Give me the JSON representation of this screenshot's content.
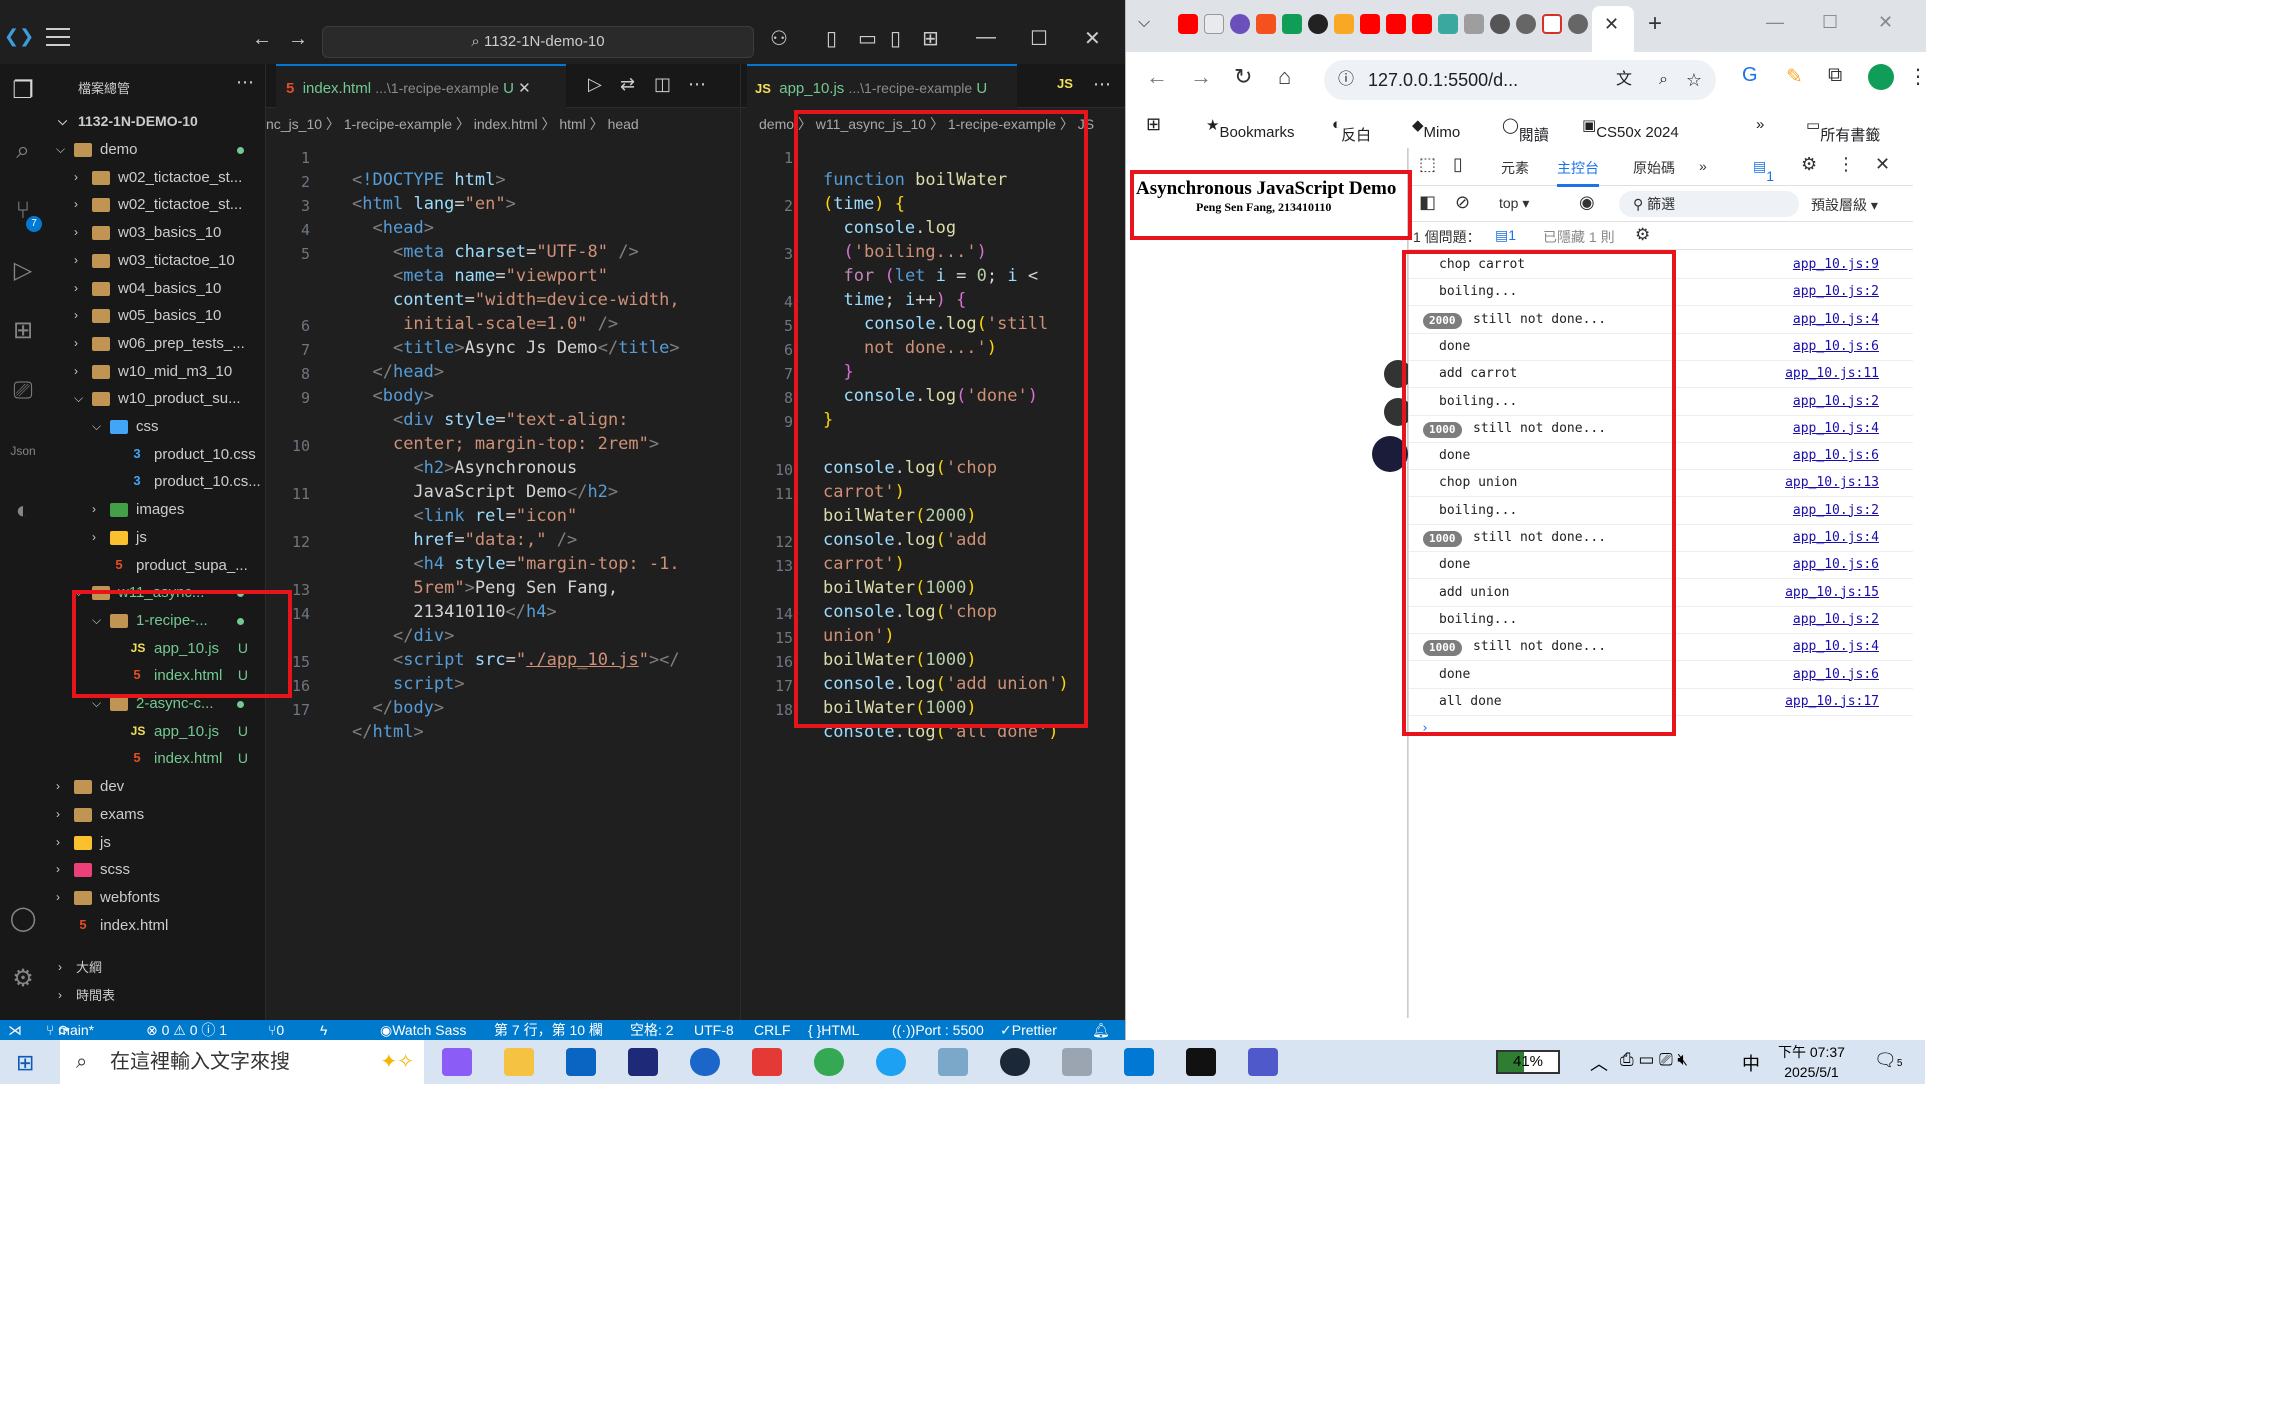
{
  "vscode": {
    "search_text": "1132-1N-demo-10",
    "explorer_title": "檔案總管",
    "workspace": "1132-1N-DEMO-10",
    "tree": [
      {
        "label": "demo",
        "indent": 0,
        "type": "folder",
        "open": true,
        "dot": true
      },
      {
        "label": "w02_tictactoe_st...",
        "indent": 1,
        "type": "folder"
      },
      {
        "label": "w02_tictactoe_st...",
        "indent": 1,
        "type": "folder"
      },
      {
        "label": "w03_basics_10",
        "indent": 1,
        "type": "folder"
      },
      {
        "label": "w03_tictactoe_10",
        "indent": 1,
        "type": "folder"
      },
      {
        "label": "w04_basics_10",
        "indent": 1,
        "type": "folder"
      },
      {
        "label": "w05_basics_10",
        "indent": 1,
        "type": "folder"
      },
      {
        "label": "w06_prep_tests_...",
        "indent": 1,
        "type": "folder"
      },
      {
        "label": "w10_mid_m3_10",
        "indent": 1,
        "type": "folder"
      },
      {
        "label": "w10_product_su...",
        "indent": 1,
        "type": "folder",
        "open": true
      },
      {
        "label": "css",
        "indent": 2,
        "type": "folder-css",
        "open": true
      },
      {
        "label": "product_10.css",
        "indent": 3,
        "type": "file-css"
      },
      {
        "label": "product_10.cs...",
        "indent": 3,
        "type": "file-css"
      },
      {
        "label": "images",
        "indent": 2,
        "type": "folder-img"
      },
      {
        "label": "js",
        "indent": 2,
        "type": "folder-js"
      },
      {
        "label": "product_supa_...",
        "indent": 2,
        "type": "file-html"
      },
      {
        "label": "w11_async...",
        "indent": 1,
        "type": "folder",
        "open": true,
        "dot": true,
        "green": true
      },
      {
        "label": "1-recipe-...",
        "indent": 2,
        "type": "folder",
        "open": true,
        "dot": true,
        "green": true
      },
      {
        "label": "app_10.js",
        "indent": 3,
        "type": "file-js",
        "status": "U",
        "green": true
      },
      {
        "label": "index.html",
        "indent": 3,
        "type": "file-html",
        "status": "U",
        "green": true
      },
      {
        "label": "2-async-c...",
        "indent": 2,
        "type": "folder",
        "open": true,
        "dot": true,
        "green": true
      },
      {
        "label": "app_10.js",
        "indent": 3,
        "type": "file-js",
        "status": "U",
        "green": true
      },
      {
        "label": "index.html",
        "indent": 3,
        "type": "file-html",
        "status": "U",
        "green": true
      },
      {
        "label": "dev",
        "indent": 0,
        "type": "folder"
      },
      {
        "label": "exams",
        "indent": 0,
        "type": "folder"
      },
      {
        "label": "js",
        "indent": 0,
        "type": "folder-js"
      },
      {
        "label": "scss",
        "indent": 0,
        "type": "folder-scss"
      },
      {
        "label": "webfonts",
        "indent": 0,
        "type": "folder"
      },
      {
        "label": "index.html",
        "indent": 0,
        "type": "file-html",
        "nochev": true
      }
    ],
    "outline_label": "大綱",
    "timeline_label": "時間表",
    "left_tab": {
      "name": "index.html",
      "path": "...\\1-recipe-example",
      "status": "U"
    },
    "left_crumb": "nc_js_10 〉 1-recipe-example 〉 index.html 〉 html 〉 head",
    "right_tab": {
      "name": "app_10.js",
      "path": "...\\1-recipe-example",
      "status": "U"
    },
    "right_crumb": "demo 〉 w11_async_js_10 〉 1-recipe-example 〉 JS",
    "html_line_numbers": [
      "1",
      "2",
      "3",
      "4",
      "5",
      "",
      "",
      "6",
      "7",
      "8",
      "9",
      "",
      "10",
      "",
      "11",
      "",
      "12",
      "",
      "13",
      "14",
      "",
      "15",
      "16",
      "17"
    ],
    "js_line_numbers": [
      "1",
      "",
      "2",
      "",
      "3",
      "",
      "4",
      "5",
      "6",
      "7",
      "8",
      "9",
      "",
      "10",
      "11",
      "",
      "12",
      "13",
      "",
      "14",
      "15",
      "16",
      "17",
      "18"
    ],
    "statusbar": {
      "branch": "main*",
      "problems": "⊗ 0 ⚠ 0 ⓘ 1",
      "ports": "0",
      "watch": "Watch Sass",
      "position": "第 7 行，第 10 欄",
      "spaces": "空格: 2",
      "encoding": "UTF-8",
      "eol": "CRLF",
      "language": "HTML",
      "port": "Port : 5500",
      "prettier": "Prettier"
    }
  },
  "chrome": {
    "url": "127.0.0.1:5500/d...",
    "bookmarks": [
      "Bookmarks",
      "反白",
      "Mimo",
      "閱讀",
      "CS50x 2024",
      "所有書籤"
    ],
    "page": {
      "title": "Asynchronous JavaScript Demo",
      "subtitle": "Peng Sen Fang, 213410110"
    },
    "devtools": {
      "tabs": [
        "元素",
        "主控台",
        "原始碼"
      ],
      "issues_count": "1",
      "context": "top",
      "filter_placeholder": "篩選",
      "levels": "預設層級",
      "issues_text": "1 個問題：",
      "issues_badge": "1",
      "hidden_text": "已隱藏 1 則",
      "logs": [
        {
          "msg": "chop carrot",
          "src": "app_10.js:9"
        },
        {
          "msg": "boiling...",
          "src": "app_10.js:2"
        },
        {
          "msg": "still not done...",
          "badge": "2000",
          "src": "app_10.js:4"
        },
        {
          "msg": "done",
          "src": "app_10.js:6"
        },
        {
          "msg": "add carrot",
          "src": "app_10.js:11"
        },
        {
          "msg": "boiling...",
          "src": "app_10.js:2"
        },
        {
          "msg": "still not done...",
          "badge": "1000",
          "src": "app_10.js:4"
        },
        {
          "msg": "done",
          "src": "app_10.js:6"
        },
        {
          "msg": "chop union",
          "src": "app_10.js:13"
        },
        {
          "msg": "boiling...",
          "src": "app_10.js:2"
        },
        {
          "msg": "still not done...",
          "badge": "1000",
          "src": "app_10.js:4"
        },
        {
          "msg": "done",
          "src": "app_10.js:6"
        },
        {
          "msg": "add union",
          "src": "app_10.js:15"
        },
        {
          "msg": "boiling...",
          "src": "app_10.js:2"
        },
        {
          "msg": "still not done...",
          "badge": "1000",
          "src": "app_10.js:4"
        },
        {
          "msg": "done",
          "src": "app_10.js:6"
        },
        {
          "msg": "all done",
          "src": "app_10.js:17"
        }
      ]
    }
  },
  "taskbar": {
    "search_placeholder": "在這裡輸入文字來搜",
    "battery": "41%",
    "ime": "中",
    "time": "下午 07:37",
    "date": "2025/5/1",
    "notif": "5"
  },
  "colors": {
    "highlight_red": "#e8141b",
    "vscode_bg": "#1f1f1f",
    "statusbar_blue": "#007acc"
  }
}
